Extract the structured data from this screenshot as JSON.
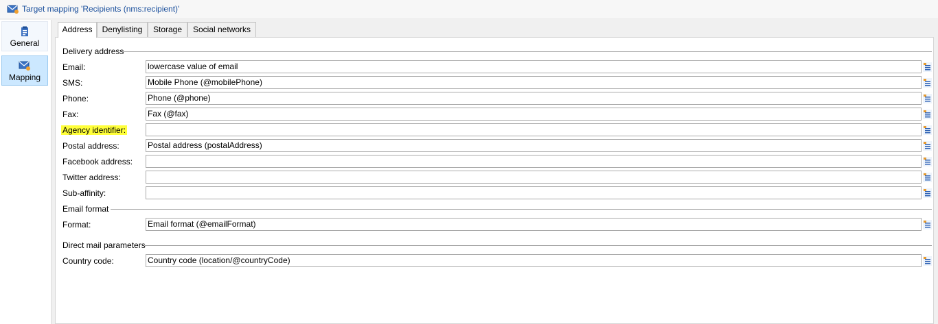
{
  "window": {
    "title": "Target mapping 'Recipients (nms:recipient)'",
    "title_icon": "envelope-target-icon"
  },
  "sidebar": {
    "items": [
      {
        "label": "General",
        "icon": "clipboard-icon",
        "selected": false
      },
      {
        "label": "Mapping",
        "icon": "envelope-mapping-icon",
        "selected": true
      }
    ]
  },
  "tabs": [
    {
      "label": "Address",
      "active": true
    },
    {
      "label": "Denylisting",
      "active": false
    },
    {
      "label": "Storage",
      "active": false
    },
    {
      "label": "Social networks",
      "active": false
    }
  ],
  "sections": {
    "delivery": "Delivery address",
    "email_format": "Email format",
    "direct_mail": "Direct mail parameters"
  },
  "fields": {
    "email": {
      "label": "Email:",
      "value": "lowercase value of email"
    },
    "sms": {
      "label": "SMS:",
      "value": "Mobile Phone (@mobilePhone)"
    },
    "phone": {
      "label": "Phone:",
      "value": "Phone (@phone)"
    },
    "fax": {
      "label": "Fax:",
      "value": "Fax (@fax)"
    },
    "agency": {
      "label": "Agency identifier:",
      "value": "",
      "highlighted": true
    },
    "postal": {
      "label": "Postal address:",
      "value": "Postal address (postalAddress)"
    },
    "facebook": {
      "label": "Facebook address:",
      "value": ""
    },
    "twitter": {
      "label": "Twitter address:",
      "value": ""
    },
    "subaffinity": {
      "label": "Sub-affinity:",
      "value": ""
    },
    "format": {
      "label": "Format:",
      "value": "Email format (@emailFormat)"
    },
    "country": {
      "label": "Country code:",
      "value": "Country code (location/@countryCode)"
    }
  },
  "colors": {
    "title_text": "#1a4f9c",
    "sidebar_selected": "#cce8ff",
    "highlight": "#ffff3a"
  }
}
